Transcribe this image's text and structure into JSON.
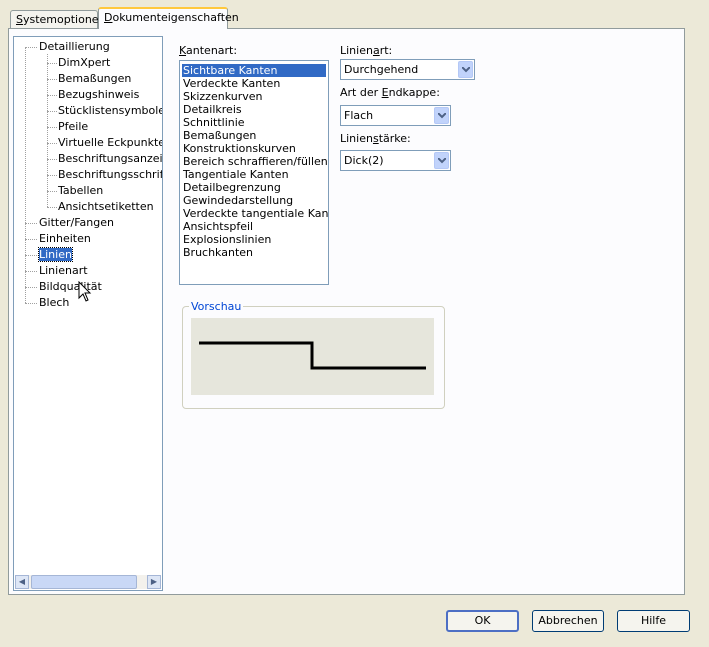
{
  "tabs": [
    {
      "label_prefix": "",
      "label_accel": "S",
      "label_rest": "ystemoptionen"
    },
    {
      "label_prefix": "",
      "label_accel": "D",
      "label_rest": "okumenteigenschaften"
    }
  ],
  "tree": {
    "items": [
      "Detaillierung",
      "DimXpert",
      "Bemaßungen",
      "Bezugshinweis",
      "Stücklistensymbole",
      "Pfeile",
      "Virtuelle Eckpunkte",
      "Beschriftungsanzeige",
      "Beschriftungsschriftart",
      "Tabellen",
      "Ansichtsetiketten",
      "Gitter/Fangen",
      "Einheiten",
      "Linien",
      "Linienart",
      "Bildqualität",
      "Blech"
    ],
    "selected": "Linien"
  },
  "kantenart": {
    "label_accel": "K",
    "label_rest": "antenart:",
    "items": [
      "Sichtbare Kanten",
      "Verdeckte Kanten",
      "Skizzenkurven",
      "Detailkreis",
      "Schnittlinie",
      "Bemaßungen",
      "Konstruktionskurven",
      "Bereich schraffieren/füllen",
      "Tangentiale Kanten",
      "Detailbegrenzung",
      "Gewindedarstellung",
      "Verdeckte tangentiale Kanten",
      "Ansichtspfeil",
      "Explosionslinien",
      "Bruchkanten"
    ],
    "selected": "Sichtbare Kanten"
  },
  "linienart": {
    "label_a": "Linien",
    "label_accel": "a",
    "label_b": "rt:",
    "value": "Durchgehend"
  },
  "endkappe": {
    "label_a": "Art der ",
    "label_accel": "E",
    "label_b": "ndkappe:",
    "value": "Flach"
  },
  "linienstaerke": {
    "label_a": "Linien",
    "label_accel": "s",
    "label_b": "tärke:",
    "value": "Dick(2)"
  },
  "preview": {
    "title": "Vorschau"
  },
  "buttons": {
    "ok": "OK",
    "cancel": "Abbrechen",
    "help": "Hilfe"
  }
}
